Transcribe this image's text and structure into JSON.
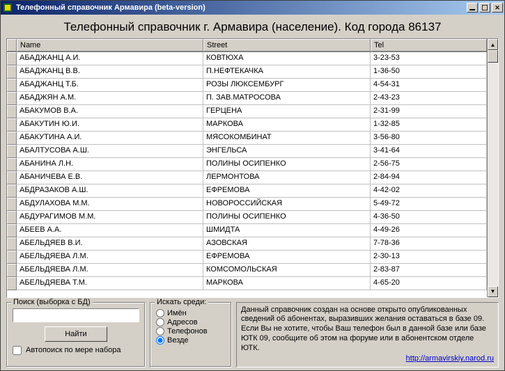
{
  "window": {
    "title": "Телефонный справочник Армавира (beta-version)"
  },
  "heading": "Телефонный справочник г. Армавира (население). Код города 86137",
  "columns": {
    "name": "Name",
    "street": "Street",
    "tel": "Tel"
  },
  "rows": [
    {
      "name": "АБАДЖАНЦ А.И.",
      "street": "КОВТЮХА",
      "tel": "3-23-53"
    },
    {
      "name": "АБАДЖАНЦ В.В.",
      "street": "П.НЕФТЕКАЧКА",
      "tel": "1-36-50"
    },
    {
      "name": "АБАДЖАНЦ Т.Б.",
      "street": "РОЗЫ ЛЮКСЕМБУРГ",
      "tel": "4-54-31"
    },
    {
      "name": "АБАДЖЯН А.М.",
      "street": "П. ЗАВ.МАТРОСОВА",
      "tel": "2-43-23"
    },
    {
      "name": "АБАКУМОВ В.А.",
      "street": "ГЕРЦЕНА",
      "tel": "2-31-99"
    },
    {
      "name": "АБАКУТИН Ю.И.",
      "street": "МАРКОВА",
      "tel": "1-32-85"
    },
    {
      "name": "АБАКУТИНА А.И.",
      "street": "МЯСОКОМБИНАТ",
      "tel": "3-56-80"
    },
    {
      "name": "АБАЛТУСОВА А.Ш.",
      "street": "ЭНГЕЛЬСА",
      "tel": "3-41-64"
    },
    {
      "name": "АБАНИНА Л.Н.",
      "street": "ПОЛИНЫ ОСИПЕНКО",
      "tel": "2-56-75"
    },
    {
      "name": "АБАНИЧЕВА Е.В.",
      "street": "ЛЕРМОНТОВА",
      "tel": "2-84-94"
    },
    {
      "name": "АБДРАЗАКОВ А.Ш.",
      "street": "ЕФРЕМОВА",
      "tel": "4-42-02"
    },
    {
      "name": "АБДУЛАХОВА М.М.",
      "street": "НОВОРОССИЙСКАЯ",
      "tel": "5-49-72"
    },
    {
      "name": "АБДУРАГИМОВ М.М.",
      "street": "ПОЛИНЫ ОСИПЕНКО",
      "tel": "4-36-50"
    },
    {
      "name": "АБЕЕВ А.А.",
      "street": "ШМИДТА",
      "tel": "4-49-26"
    },
    {
      "name": "АБЕЛЬДЯЕВ В.И.",
      "street": "АЗОВСКАЯ",
      "tel": "7-78-36"
    },
    {
      "name": "АБЕЛЬДЯЕВА Л.М.",
      "street": "ЕФРЕМОВА",
      "tel": "2-30-13"
    },
    {
      "name": "АБЕЛЬДЯЕВА Л.М.",
      "street": "КОМСОМОЛЬСКАЯ",
      "tel": "2-83-87"
    },
    {
      "name": "АБЕЛЬДЯЕВА Т.М.",
      "street": "МАРКОВА",
      "tel": "4-65-20"
    }
  ],
  "search": {
    "legend": "Поиск (выборка с БД)",
    "find_label": "Найти",
    "autosuggest_label": "Автопоиск по мере набора",
    "value": ""
  },
  "radios": {
    "legend": "Искать среди:",
    "options": [
      {
        "label": "Имён",
        "checked": false
      },
      {
        "label": "Адресов",
        "checked": false
      },
      {
        "label": "Телефонов",
        "checked": false
      },
      {
        "label": "Везде",
        "checked": true
      }
    ]
  },
  "info": {
    "text": "Данный справочник создан на основе открыто опубликованных сведений об абонентах, выразивших желания оставаться в базе 09. Если Вы не хотите, чтобы Ваш телефон был в данной базе или базе ЮТК 09, сообщите об этом на форуме или в абонентском отделе ЮТК.",
    "link": "http://armavirskiy.narod.ru"
  }
}
